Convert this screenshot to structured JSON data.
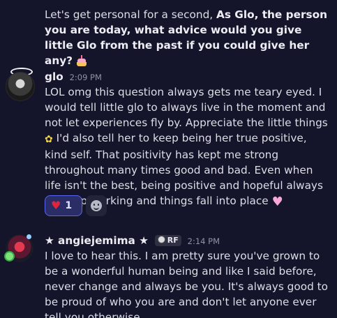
{
  "prev_message": {
    "text_plain": "Let's get personal for a second, ",
    "text_bold": "As Glo, the person you are today, what advice would you give little Glo from the past if you could give her any?"
  },
  "message1": {
    "username": "glo",
    "timestamp": "2:09 PM",
    "body_part1": "LOL omg this question always gets me teary eyed. I would tell little glo to always live in the moment and not let experiences fly by. Appreciate the little things",
    "body_part2": " I'd also tell her to keep being her true positive, kind self. That positivity has kept me strong throughout many times good and bad. Even when life isn't the best, being positive and hopeful always ends up working and things fall into place",
    "reaction": {
      "emoji": "heart",
      "count": "1"
    }
  },
  "message2": {
    "username": "★ angiejemima ★",
    "role_tag": "RF",
    "timestamp": "2:14 PM",
    "body": "I love to hear this. I am pretty sure you've grown to be a wonderful human being and like I said before, never change and always be you. It's always good to be proud of who you are and don't let anyone ever tell you otherwise."
  },
  "colors": {
    "background": "#14142a",
    "reaction_accent": "#5865f2",
    "heart_red": "#e0243c"
  },
  "icons": [
    "birthday-cake-icon",
    "flower-icon",
    "pink-heart-icon",
    "heart-icon",
    "add-reaction-icon",
    "role-icon"
  ]
}
